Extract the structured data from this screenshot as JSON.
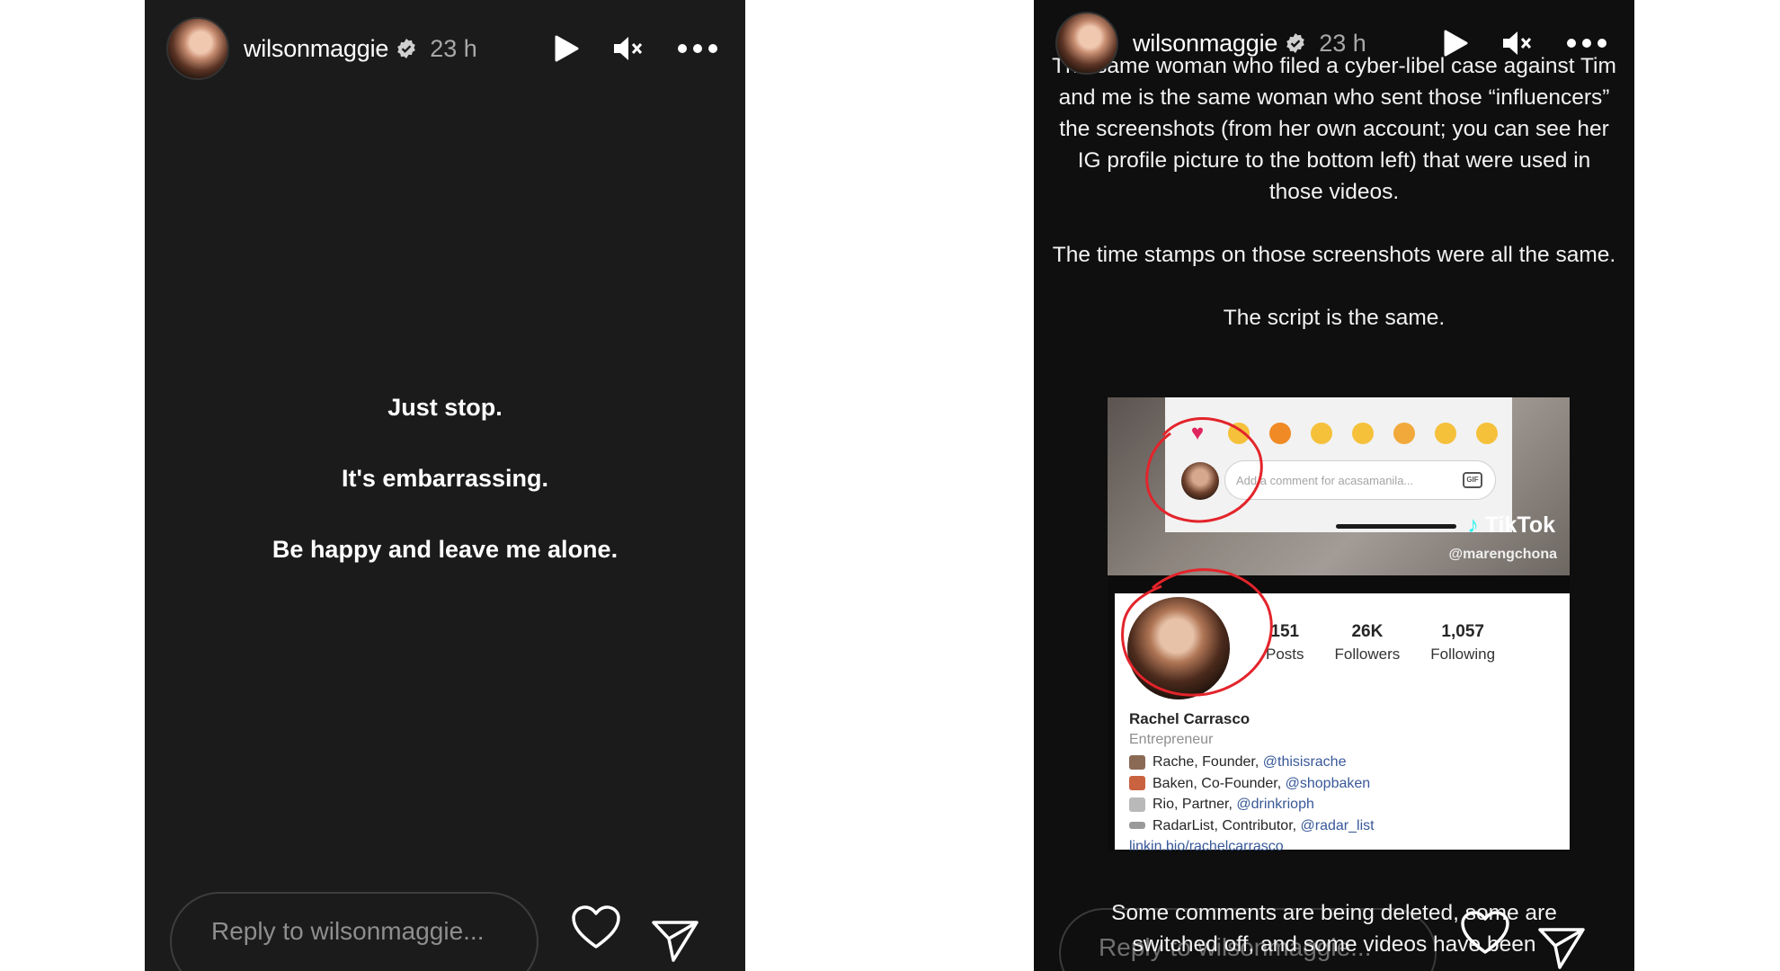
{
  "stories": {
    "left": {
      "username": "wilsonmaggie",
      "time": "23 h",
      "lines": [
        "Just stop.",
        "It's embarrassing.",
        "Be happy and leave me alone."
      ],
      "reply_placeholder": "Reply to wilsonmaggie..."
    },
    "right": {
      "username": "wilsonmaggie",
      "time": "23 h",
      "paragraphs": [
        "The same woman who filed a cyber-libel case against Tim and me is the same woman who sent those “influencers” the screenshots (from her own account; you can see her IG profile picture to the bottom left) that were used in those videos.",
        "The time stamps on those screenshots were all the same.",
        "The script is the same."
      ],
      "bottom_overlay": "Some comments are being deleted, some are switched off, and some videos have been",
      "reply_placeholder": "Reply to wilsonmaggie...",
      "tiktok": {
        "comment_placeholder": "Add a comment for acasamanila...",
        "gif": "GIF",
        "brand": "TikTok",
        "handle": "@marengchona"
      },
      "instagram_profile": {
        "stats": [
          {
            "value": "151",
            "label": "Posts"
          },
          {
            "value": "26K",
            "label": "Followers"
          },
          {
            "value": "1,057",
            "label": "Following"
          }
        ],
        "name": "Rachel Carrasco",
        "category": "Entrepreneur",
        "bio": [
          {
            "text": "Rache, Founder, ",
            "mention": "@thisisrache"
          },
          {
            "text": "Baken, Co-Founder, ",
            "mention": "@shopbaken"
          },
          {
            "text": "Rio, Partner, ",
            "mention": "@drinkrioph"
          },
          {
            "text": "RadarList, Contributor, ",
            "mention": "@radar_list"
          }
        ],
        "link": "linkin.bio/rachelcarrasco"
      }
    }
  },
  "colors": {
    "story_bg": "#1b1b1b",
    "text": "#ffffff",
    "muted": "#a8a8a8",
    "mention": "#385898",
    "annotation_red": "#e3242b"
  }
}
